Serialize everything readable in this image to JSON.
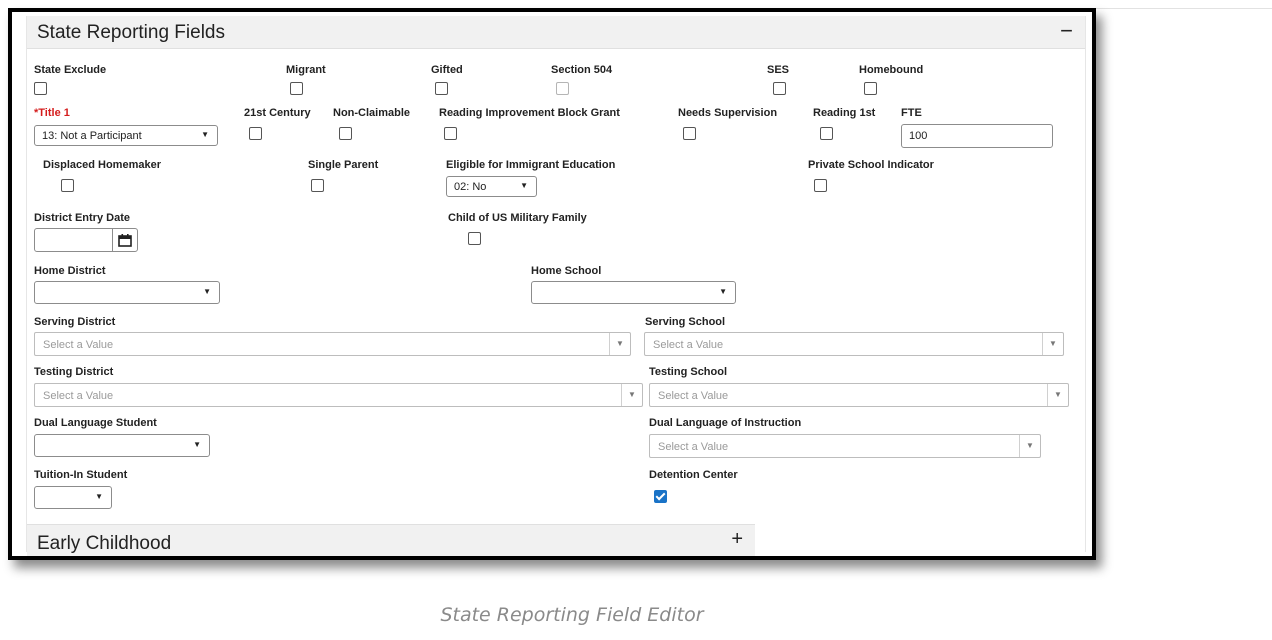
{
  "panel": {
    "title": "State Reporting Fields",
    "collapse_icon": "−"
  },
  "row1": {
    "state_exclude": "State Exclude",
    "migrant": "Migrant",
    "gifted": "Gifted",
    "section_504": "Section 504",
    "ses": "SES",
    "homebound": "Homebound"
  },
  "row2": {
    "title1": "*Title 1",
    "title1_value": "13: Not a Participant",
    "century21": "21st Century",
    "non_claimable": "Non-Claimable",
    "reading_grant": "Reading Improvement Block Grant",
    "needs_supervision": "Needs Supervision",
    "reading_1st": "Reading 1st",
    "fte": "FTE",
    "fte_value": "100"
  },
  "row3": {
    "displaced_homemaker": "Displaced Homemaker",
    "single_parent": "Single Parent",
    "immigrant_ed": "Eligible for Immigrant Education",
    "immigrant_ed_value": "02: No",
    "private_school": "Private School Indicator"
  },
  "row4": {
    "district_entry_date": "District Entry Date",
    "military_family": "Child of US Military Family"
  },
  "row5": {
    "home_district": "Home District",
    "home_school": "Home School"
  },
  "row6": {
    "serving_district": "Serving District",
    "serving_school": "Serving School",
    "placeholder": "Select a Value"
  },
  "row7": {
    "testing_district": "Testing District",
    "testing_school": "Testing School",
    "placeholder": "Select a Value"
  },
  "row8": {
    "dual_language_student": "Dual Language Student",
    "dual_language_instruction": "Dual Language of Instruction",
    "placeholder": "Select a Value"
  },
  "row9": {
    "tuition_in": "Tuition-In Student",
    "detention_center": "Detention Center",
    "detention_center_checked": true
  },
  "early_childhood": {
    "title": "Early Childhood",
    "expand_icon": "+"
  },
  "caption": "State Reporting Field Editor",
  "icons": {
    "dropdown": "▼"
  },
  "colors": {
    "required": "#d41c1c",
    "checked": "#1a73c7",
    "header_bg": "#f1f1f1"
  }
}
